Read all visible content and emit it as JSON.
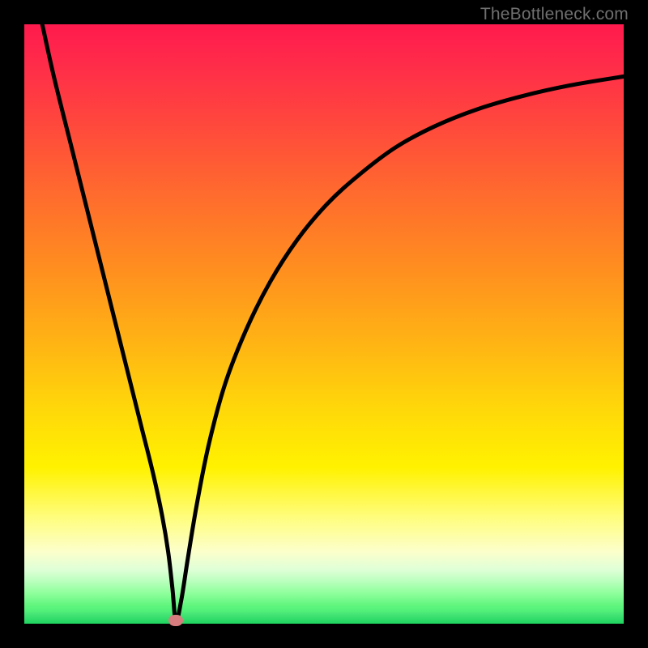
{
  "watermark": {
    "text": "TheBottleneck.com"
  },
  "chart_data": {
    "type": "line",
    "title": "",
    "xlabel": "",
    "ylabel": "",
    "xlim": [
      0,
      100
    ],
    "ylim": [
      0,
      100
    ],
    "series": [
      {
        "name": "curve",
        "x": [
          3,
          5,
          8,
          11,
          14,
          17,
          19.5,
          21.5,
          23,
          24,
          24.7,
          25.3,
          26.2,
          27.3,
          28.8,
          30.8,
          33.5,
          37,
          41,
          45.5,
          50.5,
          56,
          62,
          68.5,
          75.5,
          83,
          91,
          100
        ],
        "values": [
          100,
          91,
          79,
          67,
          55,
          43,
          33,
          25,
          18,
          12,
          6,
          0.5,
          4,
          11,
          20,
          30,
          40,
          49,
          57,
          64,
          70,
          75,
          79.5,
          83,
          85.8,
          88,
          89.8,
          91.3
        ]
      }
    ],
    "marker": {
      "x": 25.3,
      "y": 0.5
    },
    "background_gradient": {
      "top": "#ff1a4d",
      "mid_upper": "#ff8c20",
      "mid": "#fff200",
      "mid_lower": "#fcffcb",
      "bottom": "#1fd45f"
    }
  }
}
